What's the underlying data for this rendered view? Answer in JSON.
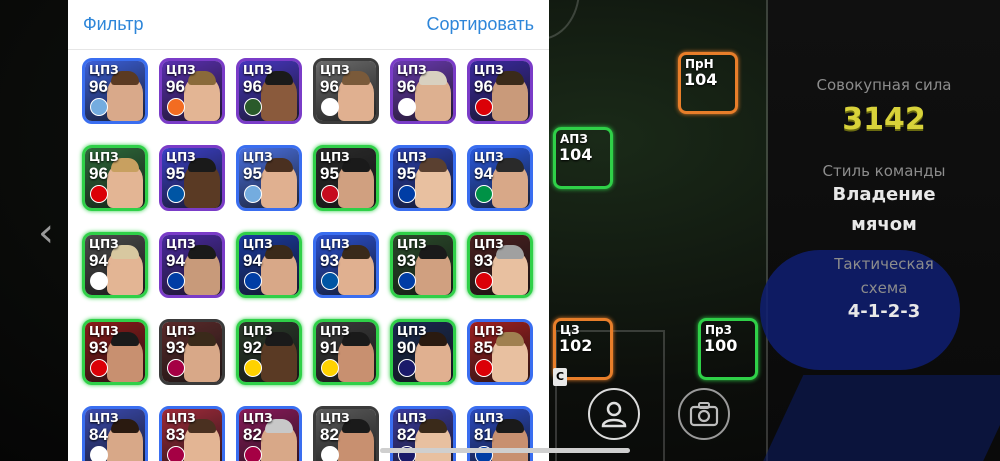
{
  "header": {
    "filter_label": "Фильтр",
    "sort_label": "Сортировать"
  },
  "cards": [
    {
      "pos": "ЦПЗ",
      "rating": "96",
      "frame": "f-blue",
      "bg": "#3b5fd8",
      "skin": "#d9a98a",
      "hair": "#5b3a22",
      "badge": "#74acdf"
    },
    {
      "pos": "ЦПЗ",
      "rating": "96",
      "frame": "f-epic",
      "bg": "#5a2fb0",
      "skin": "#e3b594",
      "hair": "#8a6a3a",
      "badge": "#f36c21"
    },
    {
      "pos": "ЦПЗ",
      "rating": "96",
      "frame": "f-epic",
      "bg": "#4736c0",
      "skin": "#8a5a3c",
      "hair": "#1a1a1a",
      "badge": "#2a5a2a"
    },
    {
      "pos": "ЦПЗ",
      "rating": "96",
      "frame": "f-standard",
      "bg": "#6b6b6b",
      "skin": "#e0b090",
      "hair": "#7a5a3a",
      "badge": "#ffffff"
    },
    {
      "pos": "ЦПЗ",
      "rating": "96",
      "frame": "f-epic",
      "bg": "#6a3ab0",
      "skin": "#ddb090",
      "hair": "#d8d0c0",
      "badge": "#ffffff"
    },
    {
      "pos": "ЦПЗ",
      "rating": "96",
      "frame": "f-epic",
      "bg": "#3a2aa0",
      "skin": "#c99a7a",
      "hair": "#3a2a1a",
      "badge": "#db0007"
    },
    {
      "pos": "ЦПЗ",
      "rating": "96",
      "frame": "f-green",
      "bg": "#2e6a3a",
      "skin": "#e3b594",
      "hair": "#c8a060",
      "badge": "#db0007"
    },
    {
      "pos": "ЦПЗ",
      "rating": "95",
      "frame": "f-epic",
      "bg": "#3b40c8",
      "skin": "#5a3a24",
      "hair": "#1a1a1a",
      "badge": "#0055a4"
    },
    {
      "pos": "ЦПЗ",
      "rating": "95",
      "frame": "f-blue",
      "bg": "#4a70e0",
      "skin": "#e0b090",
      "hair": "#4a3020",
      "badge": "#74acdf"
    },
    {
      "pos": "ЦПЗ",
      "rating": "95",
      "frame": "f-green",
      "bg": "#2a2a2a",
      "skin": "#d0a080",
      "hair": "#1a1a1a",
      "badge": "#c60b1e"
    },
    {
      "pos": "ЦПЗ",
      "rating": "95",
      "frame": "f-blue",
      "bg": "#2a40b0",
      "skin": "#e8c0a0",
      "hair": "#5a4030",
      "badge": "#003da5"
    },
    {
      "pos": "ЦПЗ",
      "rating": "94",
      "frame": "f-blue",
      "bg": "#2a5ae0",
      "skin": "#d8a888",
      "hair": "#2a2a2a",
      "badge": "#009246"
    },
    {
      "pos": "ЦПЗ",
      "rating": "94",
      "frame": "f-green",
      "bg": "#4a4a4a",
      "skin": "#e3b594",
      "hair": "#d8c8a0",
      "badge": "#ffffff"
    },
    {
      "pos": "ЦПЗ",
      "rating": "94",
      "frame": "f-epic",
      "bg": "#4a2aa0",
      "skin": "#c89a7a",
      "hair": "#1a1a1a",
      "badge": "#003da5"
    },
    {
      "pos": "ЦПЗ",
      "rating": "94",
      "frame": "f-green",
      "bg": "#1a3aa0",
      "skin": "#d8a888",
      "hair": "#3a2a1a",
      "badge": "#003da5"
    },
    {
      "pos": "ЦПЗ",
      "rating": "93",
      "frame": "f-blue",
      "bg": "#2a50d0",
      "skin": "#e0b090",
      "hair": "#3a2a1a",
      "badge": "#0055a4"
    },
    {
      "pos": "ЦПЗ",
      "rating": "93",
      "frame": "f-green",
      "bg": "#2a4a2a",
      "skin": "#d0a080",
      "hair": "#1a1a1a",
      "badge": "#003da5"
    },
    {
      "pos": "ЦПЗ",
      "rating": "93",
      "frame": "f-green",
      "bg": "#4a2020",
      "skin": "#e8c0a0",
      "hair": "#a0a0a0",
      "badge": "#db0007"
    },
    {
      "pos": "ЦПЗ",
      "rating": "93",
      "frame": "f-green",
      "bg": "#8a1a1a",
      "skin": "#c89070",
      "hair": "#1a1a1a",
      "badge": "#db0007"
    },
    {
      "pos": "ЦПЗ",
      "rating": "93",
      "frame": "f-standard",
      "bg": "#5a2a2a",
      "skin": "#d8a888",
      "hair": "#3a2a1a",
      "badge": "#a50044"
    },
    {
      "pos": "ЦПЗ",
      "rating": "92",
      "frame": "f-green",
      "bg": "#2a3a2a",
      "skin": "#5a3a24",
      "hair": "#1a1a1a",
      "badge": "#ffd200"
    },
    {
      "pos": "ЦПЗ",
      "rating": "91",
      "frame": "f-green",
      "bg": "#3a3a3a",
      "skin": "#c89070",
      "hair": "#1a1a1a",
      "badge": "#ffd200"
    },
    {
      "pos": "ЦПЗ",
      "rating": "90",
      "frame": "f-green",
      "bg": "#1a2a50",
      "skin": "#e0b090",
      "hair": "#2a1a10",
      "badge": "#1a1a6a"
    },
    {
      "pos": "ЦПЗ",
      "rating": "85",
      "frame": "f-blue",
      "bg": "#a02020",
      "skin": "#e8c0a0",
      "hair": "#a08050",
      "badge": "#db0007"
    },
    {
      "pos": "ЦПЗ",
      "rating": "84",
      "frame": "f-blue",
      "bg": "#3a4ab0",
      "skin": "#d8a888",
      "hair": "#2a1a10",
      "badge": "#ffffff"
    },
    {
      "pos": "ЦПЗ",
      "rating": "83",
      "frame": "f-blue",
      "bg": "#a02a3a",
      "skin": "#e3b594",
      "hair": "#4a3020",
      "badge": "#a50044"
    },
    {
      "pos": "ЦПЗ",
      "rating": "82",
      "frame": "f-blue",
      "bg": "#8a1a5a",
      "skin": "#d8a888",
      "hair": "#c8c8c8",
      "badge": "#a50044"
    },
    {
      "pos": "ЦПЗ",
      "rating": "82",
      "frame": "f-standard",
      "bg": "#5a5a5a",
      "skin": "#c89070",
      "hair": "#1a1a1a",
      "badge": "#ffffff"
    },
    {
      "pos": "ЦПЗ",
      "rating": "82",
      "frame": "f-blue",
      "bg": "#3a3aa0",
      "skin": "#e8c0a0",
      "hair": "#3a2a1a",
      "badge": "#1a1a6a"
    },
    {
      "pos": "ЦПЗ",
      "rating": "81",
      "frame": "f-blue",
      "bg": "#2a4ac0",
      "skin": "#c89070",
      "hair": "#1a1a1a",
      "badge": "#003da5"
    }
  ],
  "pitch_cards": [
    {
      "pos": "ПрН",
      "rating": "104",
      "frame": "orange",
      "bg": "#3a3aa0",
      "skin": "#e3b594",
      "badge": "#a50044"
    },
    {
      "pos": "АПЗ",
      "rating": "104",
      "frame": "",
      "bg": "#2a2a3a",
      "skin": "#5a3a24",
      "badge": "#ffffff"
    },
    {
      "pos": "ЦЗ",
      "rating": "102",
      "frame": "orange",
      "bg": "#3a3030",
      "skin": "#d8a888",
      "badge": "#db0007"
    },
    {
      "pos": "Пр3",
      "rating": "100",
      "frame": "",
      "bg": "#8a2020",
      "skin": "#5a3a24",
      "badge": "#db0007"
    }
  ],
  "stats": {
    "total_power_label": "Совокупная сила",
    "total_power_value": "3142",
    "team_style_label": "Стиль команды",
    "team_style_line1": "Владение",
    "team_style_line2": "мячом",
    "tactic_label_line1": "Тактическая",
    "tactic_label_line2": "схема",
    "tactic_value": "4-1-2-3"
  },
  "captain_tag": "C",
  "icons": {
    "back": "chevron-left-icon",
    "player": "user-icon",
    "camera": "camera-icon"
  }
}
